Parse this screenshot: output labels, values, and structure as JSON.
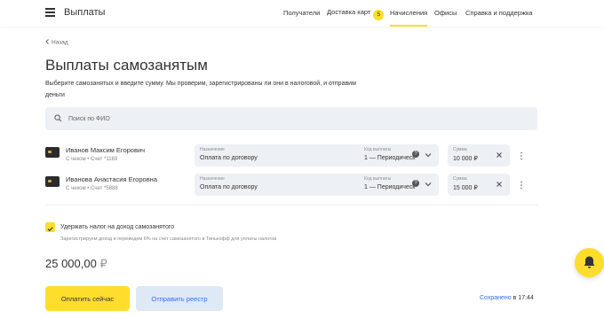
{
  "header": {
    "brand": "Выплаты",
    "nav": [
      {
        "label": "Получатели"
      },
      {
        "label": "Доставка карт",
        "badge": "5"
      },
      {
        "label": "Начисления",
        "active": true
      },
      {
        "label": "Офисы"
      },
      {
        "label": "Справка и поддержка"
      }
    ]
  },
  "page": {
    "back_label": "Назад",
    "title": "Выплаты самозанятым",
    "subtitle": "Выберите самозанятых и введите сумму. Мы проверим, зарегистрированы ли они в налоговой, и отправим деньги"
  },
  "search": {
    "placeholder": "Поиск по ФИО"
  },
  "labels": {
    "purpose": "Назначение",
    "code": "Код выплаты",
    "amount": "Сумма"
  },
  "payees": [
    {
      "name": "Иванов Максим Егорович",
      "meta": "С чеком • Счет *1169",
      "purpose": "Оплата по договору",
      "code": "1 — Периодическ",
      "amount": "10 000 ₽"
    },
    {
      "name": "Иванова Анастасия Егоровна",
      "meta": "С чеком • Счет *5888",
      "purpose": "Оплата по договору",
      "code": "1 — Периодическ",
      "amount": "15 000 ₽"
    }
  ],
  "tax": {
    "checked": true,
    "label": "Удержать налог на доход самозанятого",
    "note": "Зарегистрируем доход и переведем 6% на счет самозанятого в Тинькофф для уплаты налогов"
  },
  "total": {
    "amount": "25 000,00",
    "currency": "₽"
  },
  "actions": {
    "pay_label": "Оплатить сейчас",
    "send_label": "Отправить реестр"
  },
  "saved": {
    "link": "Сохранено",
    "time": "в 17:44"
  },
  "colors": {
    "accent": "#ffdd2d",
    "link": "#336fee",
    "field_bg": "#edf0f4"
  },
  "icons": [
    "menu-icon",
    "chevron-left-icon",
    "search-icon",
    "card-icon",
    "close-icon",
    "help-icon",
    "chevron-down-icon",
    "more-vertical-icon",
    "check-icon",
    "bell-icon"
  ]
}
